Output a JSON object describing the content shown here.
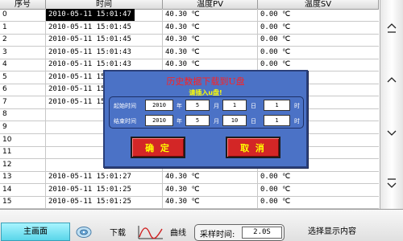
{
  "table": {
    "headers": {
      "no": "序号",
      "time": "时间",
      "pv": "温度PV",
      "sv": "温度SV"
    },
    "rows": [
      {
        "no": "0",
        "time": "2010-05-11 15:01:47",
        "pv": "40.30 ℃",
        "sv": "0.00 ℃",
        "selected": true
      },
      {
        "no": "1",
        "time": "2010-05-11 15:01:45",
        "pv": "40.30 ℃",
        "sv": "0.00 ℃"
      },
      {
        "no": "2",
        "time": "2010-05-11 15:01:45",
        "pv": "40.30 ℃",
        "sv": "0.00 ℃"
      },
      {
        "no": "3",
        "time": "2010-05-11 15:01:43",
        "pv": "40.30 ℃",
        "sv": "0.00 ℃"
      },
      {
        "no": "4",
        "time": "2010-05-11 15:01:43",
        "pv": "40.30 ℃",
        "sv": "0.00 ℃"
      },
      {
        "no": "5",
        "time": "2010-05-11 15:01:41",
        "pv": "",
        "sv": "0.00 ℃"
      },
      {
        "no": "6",
        "time": "2010-05-11 15:01:39",
        "pv": "",
        "sv": "0.00 ℃"
      },
      {
        "no": "7",
        "time": "2010-05-11 15:01:39",
        "pv": "",
        "sv": "0.00 ℃"
      },
      {
        "no": "8",
        "time": "",
        "pv": "",
        "sv": "0.00 ℃"
      },
      {
        "no": "9",
        "time": "",
        "pv": "",
        "sv": "0.00 ℃"
      },
      {
        "no": "10",
        "time": "",
        "pv": "",
        "sv": "0.00 ℃"
      },
      {
        "no": "11",
        "time": "",
        "pv": "",
        "sv": "0.00 ℃"
      },
      {
        "no": "12",
        "time": "",
        "pv": "",
        "sv": "0.00 ℃"
      },
      {
        "no": "13",
        "time": "2010-05-11 15:01:27",
        "pv": "40.30 ℃",
        "sv": "0.00 ℃"
      },
      {
        "no": "14",
        "time": "2010-05-11 15:01:25",
        "pv": "40.30 ℃",
        "sv": "0.00 ℃"
      },
      {
        "no": "15",
        "time": "2010-05-11 15:01:25",
        "pv": "40.30 ℃",
        "sv": "0.00 ℃"
      }
    ]
  },
  "scroll": {
    "icons": [
      "double-chevron-up-icon",
      "chevron-up-icon",
      "chevron-down-icon",
      "double-chevron-down-icon"
    ]
  },
  "dialog": {
    "title": "历史数据下载到U盘",
    "subtitle": "请插入u盘!",
    "start": {
      "label": "起始时间",
      "year": "2010",
      "month": "5",
      "day": "1",
      "hour": "1"
    },
    "end": {
      "label": "结束时间",
      "year": "2010",
      "month": "5",
      "day": "10",
      "hour": "1"
    },
    "units": {
      "year": "年",
      "month": "月",
      "day": "日",
      "hour": "时"
    },
    "confirm": "确 定",
    "cancel": "取 消"
  },
  "toolbar": {
    "main": "主画面",
    "download": "下载",
    "curve": "曲线",
    "sample_label": "采样时间:",
    "sample_value": "2.0S",
    "select": "选择显示内容"
  },
  "colors": {
    "dialog_bg": "#4b72c6",
    "dialog_title": "#ff2020",
    "button_bg": "#d32626",
    "button_text": "#ffff00",
    "main_button": "#5ad6ea"
  }
}
